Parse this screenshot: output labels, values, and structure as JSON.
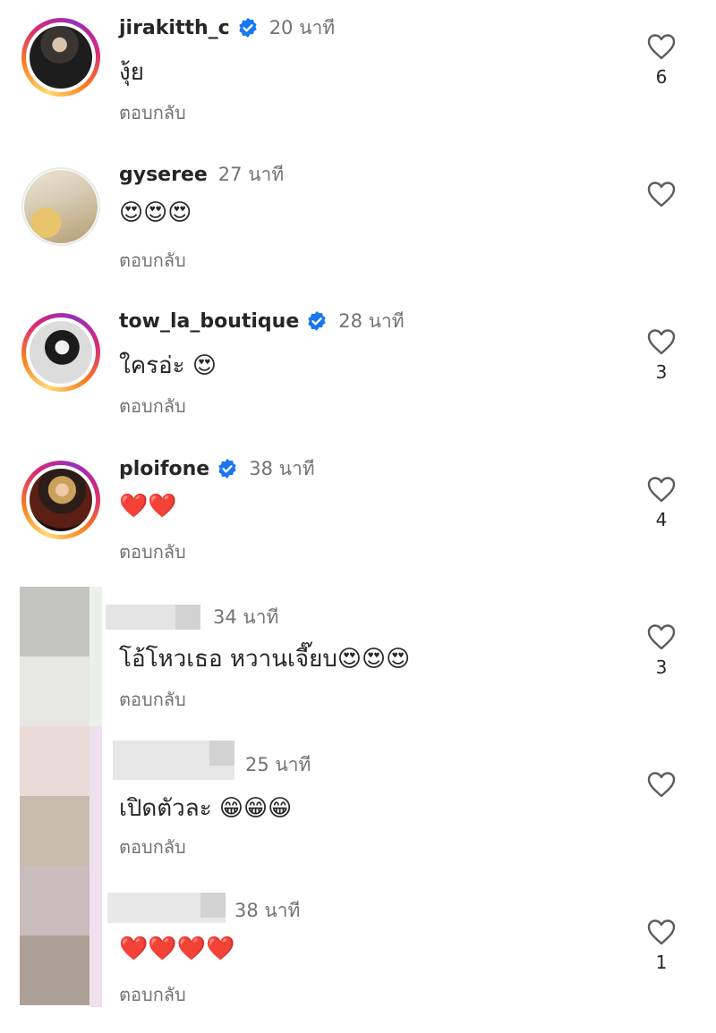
{
  "reply_label": "ตอบกลับ",
  "comments": [
    {
      "username": "jirakitth_c",
      "verified": true,
      "time": "20 นาที",
      "text": "งุ้ย",
      "likes": "6"
    },
    {
      "username": "gyseree",
      "verified": false,
      "time": "27 นาที",
      "text": "😍😍😍",
      "likes": ""
    },
    {
      "username": "tow_la_boutique",
      "verified": true,
      "time": "28 นาที",
      "text": "ใครอ่ะ 😍",
      "likes": "3"
    },
    {
      "username": "ploifone",
      "verified": true,
      "time": "38 นาที",
      "text": "❤️❤️",
      "likes": "4"
    },
    {
      "username": "",
      "verified": false,
      "time": "34 นาที",
      "text": "โอ้โหวเธอ หวานเจี๊ยบ😍😍😍",
      "likes": "3"
    },
    {
      "username": "",
      "verified": false,
      "time": "25 นาที",
      "text": "เปิดตัวละ 😁😁😁",
      "likes": ""
    },
    {
      "username": "",
      "verified": false,
      "time": "38 นาที",
      "text": "❤️❤️❤️❤️",
      "likes": "1"
    }
  ],
  "colors": {
    "verified_badge": "#1877f2",
    "secondary_text": "#737373",
    "primary_text": "#262626"
  }
}
